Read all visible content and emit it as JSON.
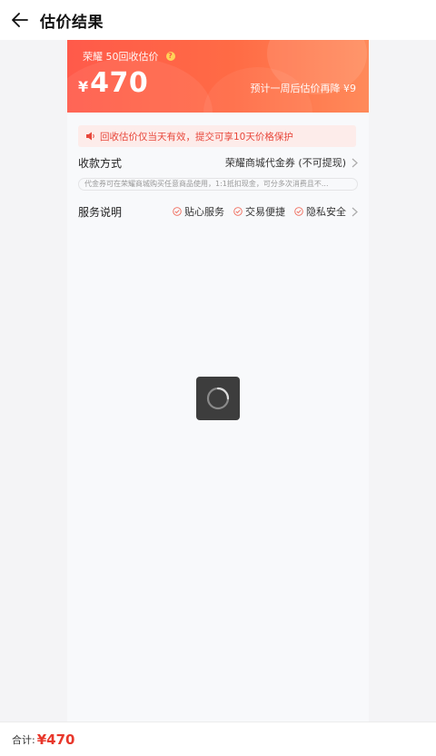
{
  "header": {
    "title": "估价结果"
  },
  "banner": {
    "label": "荣耀 50回收估价",
    "currency": "¥",
    "price": "470",
    "drop_note": "预计一周后估价再降 ¥9"
  },
  "notice": {
    "text": "回收估价仅当天有效，提交可享10天价格保护"
  },
  "payment": {
    "label": "收款方式",
    "value": "荣耀商城代金券 (不可提现)",
    "hint": "代金券可在荣耀商城购买任意商品使用，1:1抵扣现金，可分多次消费且不..."
  },
  "service": {
    "label": "服务说明",
    "items": [
      "贴心服务",
      "交易便捷",
      "隐私安全"
    ]
  },
  "footer": {
    "label": "合计:",
    "price": "¥470"
  },
  "colors": {
    "accent": "#ff5a4a",
    "price_red": "#e8372b",
    "notice_bg": "#fdecea"
  }
}
